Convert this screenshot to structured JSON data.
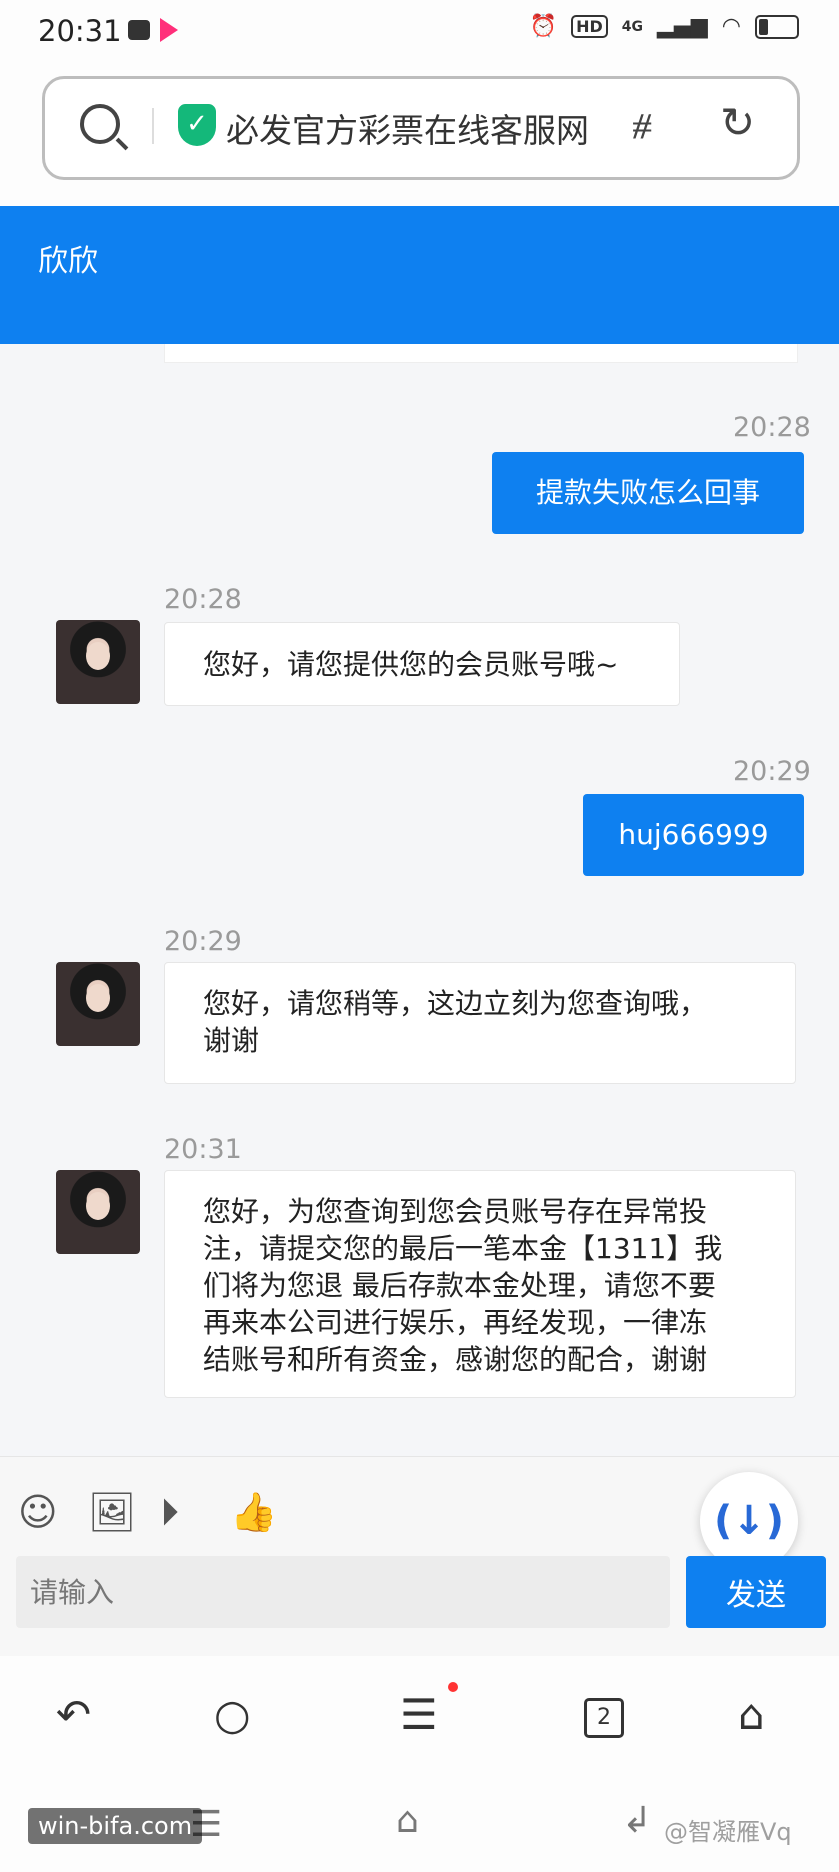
{
  "status_bar": {
    "time": "20:31",
    "hd": "HD",
    "network": "4G"
  },
  "address_bar": {
    "site_title": "必发官方彩票在线客服网"
  },
  "header": {
    "title": "欣欣"
  },
  "messages": [
    {
      "time": "20:28",
      "direction": "outgoing",
      "text": "提款失败怎么回事"
    },
    {
      "time": "20:28",
      "direction": "incoming",
      "lines": [
        "您好，请您提供您的会员账号哦~"
      ]
    },
    {
      "time": "20:29",
      "direction": "outgoing",
      "text": "huj666999"
    },
    {
      "time": "20:29",
      "direction": "incoming",
      "lines": [
        "您好，请您稍等，这边立刻为您查询哦，",
        "谢谢"
      ]
    },
    {
      "time": "20:31",
      "direction": "incoming",
      "lines": [
        "您好，为您查询到您会员账号存在异常投",
        "注，请提交您的最后一笔本金【1311】我",
        "们将为您退 最后存款本金处理，请您不要",
        "再来本公司进行娱乐，再经发现，一律冻",
        "结账号和所有资金，感谢您的配合，谢谢"
      ]
    }
  ],
  "composer": {
    "placeholder": "请输入",
    "send_label": "发送"
  },
  "tab_count": "2",
  "watermarks": {
    "left": "win-bifa.com",
    "right": "@智凝雁Vq"
  }
}
